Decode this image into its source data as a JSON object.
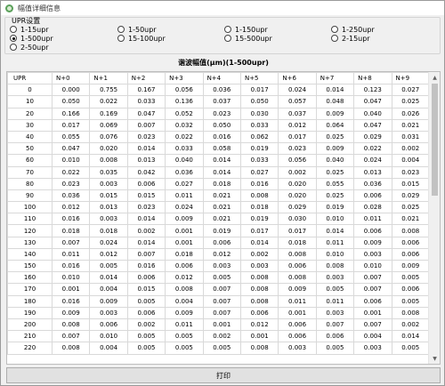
{
  "window": {
    "title": "幅值详细信息"
  },
  "upr_group": {
    "title": "UPR设置",
    "options": [
      {
        "label": "1-15upr",
        "checked": false
      },
      {
        "label": "1-50upr",
        "checked": false
      },
      {
        "label": "1-150upr",
        "checked": false
      },
      {
        "label": "1-250upr",
        "checked": false
      },
      {
        "label": "1-500upr",
        "checked": true
      },
      {
        "label": "15-100upr",
        "checked": false
      },
      {
        "label": "15-500upr",
        "checked": false
      },
      {
        "label": "2-15upr",
        "checked": false
      },
      {
        "label": "2-50upr",
        "checked": false
      }
    ]
  },
  "table": {
    "title": "谐波幅值(µm)(1-500upr)",
    "headers": [
      "UPR",
      "N+0",
      "N+1",
      "N+2",
      "N+3",
      "N+4",
      "N+5",
      "N+6",
      "N+7",
      "N+8",
      "N+9"
    ],
    "rows": [
      [
        "0",
        "0.000",
        "0.755",
        "0.167",
        "0.056",
        "0.036",
        "0.017",
        "0.024",
        "0.014",
        "0.123",
        "0.027"
      ],
      [
        "10",
        "0.050",
        "0.022",
        "0.033",
        "0.136",
        "0.037",
        "0.050",
        "0.057",
        "0.048",
        "0.047",
        "0.025"
      ],
      [
        "20",
        "0.166",
        "0.169",
        "0.047",
        "0.052",
        "0.023",
        "0.030",
        "0.037",
        "0.009",
        "0.040",
        "0.026"
      ],
      [
        "30",
        "0.017",
        "0.069",
        "0.007",
        "0.032",
        "0.050",
        "0.033",
        "0.012",
        "0.064",
        "0.047",
        "0.021"
      ],
      [
        "40",
        "0.055",
        "0.076",
        "0.023",
        "0.022",
        "0.016",
        "0.062",
        "0.017",
        "0.025",
        "0.029",
        "0.031"
      ],
      [
        "50",
        "0.047",
        "0.020",
        "0.014",
        "0.033",
        "0.058",
        "0.019",
        "0.023",
        "0.009",
        "0.022",
        "0.002"
      ],
      [
        "60",
        "0.010",
        "0.008",
        "0.013",
        "0.040",
        "0.014",
        "0.033",
        "0.056",
        "0.040",
        "0.024",
        "0.004"
      ],
      [
        "70",
        "0.022",
        "0.035",
        "0.042",
        "0.036",
        "0.014",
        "0.027",
        "0.002",
        "0.025",
        "0.013",
        "0.023"
      ],
      [
        "80",
        "0.023",
        "0.003",
        "0.006",
        "0.027",
        "0.018",
        "0.016",
        "0.020",
        "0.055",
        "0.036",
        "0.015"
      ],
      [
        "90",
        "0.036",
        "0.015",
        "0.015",
        "0.011",
        "0.021",
        "0.008",
        "0.020",
        "0.025",
        "0.006",
        "0.029"
      ],
      [
        "100",
        "0.012",
        "0.013",
        "0.023",
        "0.024",
        "0.021",
        "0.018",
        "0.029",
        "0.019",
        "0.028",
        "0.025"
      ],
      [
        "110",
        "0.016",
        "0.003",
        "0.014",
        "0.009",
        "0.021",
        "0.019",
        "0.030",
        "0.010",
        "0.011",
        "0.021"
      ],
      [
        "120",
        "0.018",
        "0.018",
        "0.002",
        "0.001",
        "0.019",
        "0.017",
        "0.017",
        "0.014",
        "0.006",
        "0.008"
      ],
      [
        "130",
        "0.007",
        "0.024",
        "0.014",
        "0.001",
        "0.006",
        "0.014",
        "0.018",
        "0.011",
        "0.009",
        "0.006"
      ],
      [
        "140",
        "0.011",
        "0.012",
        "0.007",
        "0.018",
        "0.012",
        "0.002",
        "0.008",
        "0.010",
        "0.003",
        "0.006"
      ],
      [
        "150",
        "0.016",
        "0.005",
        "0.016",
        "0.006",
        "0.003",
        "0.003",
        "0.006",
        "0.008",
        "0.010",
        "0.009"
      ],
      [
        "160",
        "0.010",
        "0.014",
        "0.006",
        "0.012",
        "0.005",
        "0.008",
        "0.008",
        "0.003",
        "0.007",
        "0.005"
      ],
      [
        "170",
        "0.001",
        "0.004",
        "0.015",
        "0.008",
        "0.007",
        "0.008",
        "0.009",
        "0.005",
        "0.007",
        "0.006"
      ],
      [
        "180",
        "0.016",
        "0.009",
        "0.005",
        "0.004",
        "0.007",
        "0.008",
        "0.011",
        "0.011",
        "0.006",
        "0.005"
      ],
      [
        "190",
        "0.009",
        "0.003",
        "0.006",
        "0.009",
        "0.007",
        "0.006",
        "0.001",
        "0.003",
        "0.001",
        "0.008"
      ],
      [
        "200",
        "0.008",
        "0.006",
        "0.002",
        "0.011",
        "0.001",
        "0.012",
        "0.006",
        "0.007",
        "0.007",
        "0.002"
      ],
      [
        "210",
        "0.007",
        "0.010",
        "0.005",
        "0.005",
        "0.002",
        "0.001",
        "0.006",
        "0.006",
        "0.004",
        "0.014"
      ],
      [
        "220",
        "0.008",
        "0.004",
        "0.005",
        "0.005",
        "0.005",
        "0.008",
        "0.003",
        "0.005",
        "0.003",
        "0.005"
      ]
    ]
  },
  "print_button": {
    "label": "打印"
  }
}
